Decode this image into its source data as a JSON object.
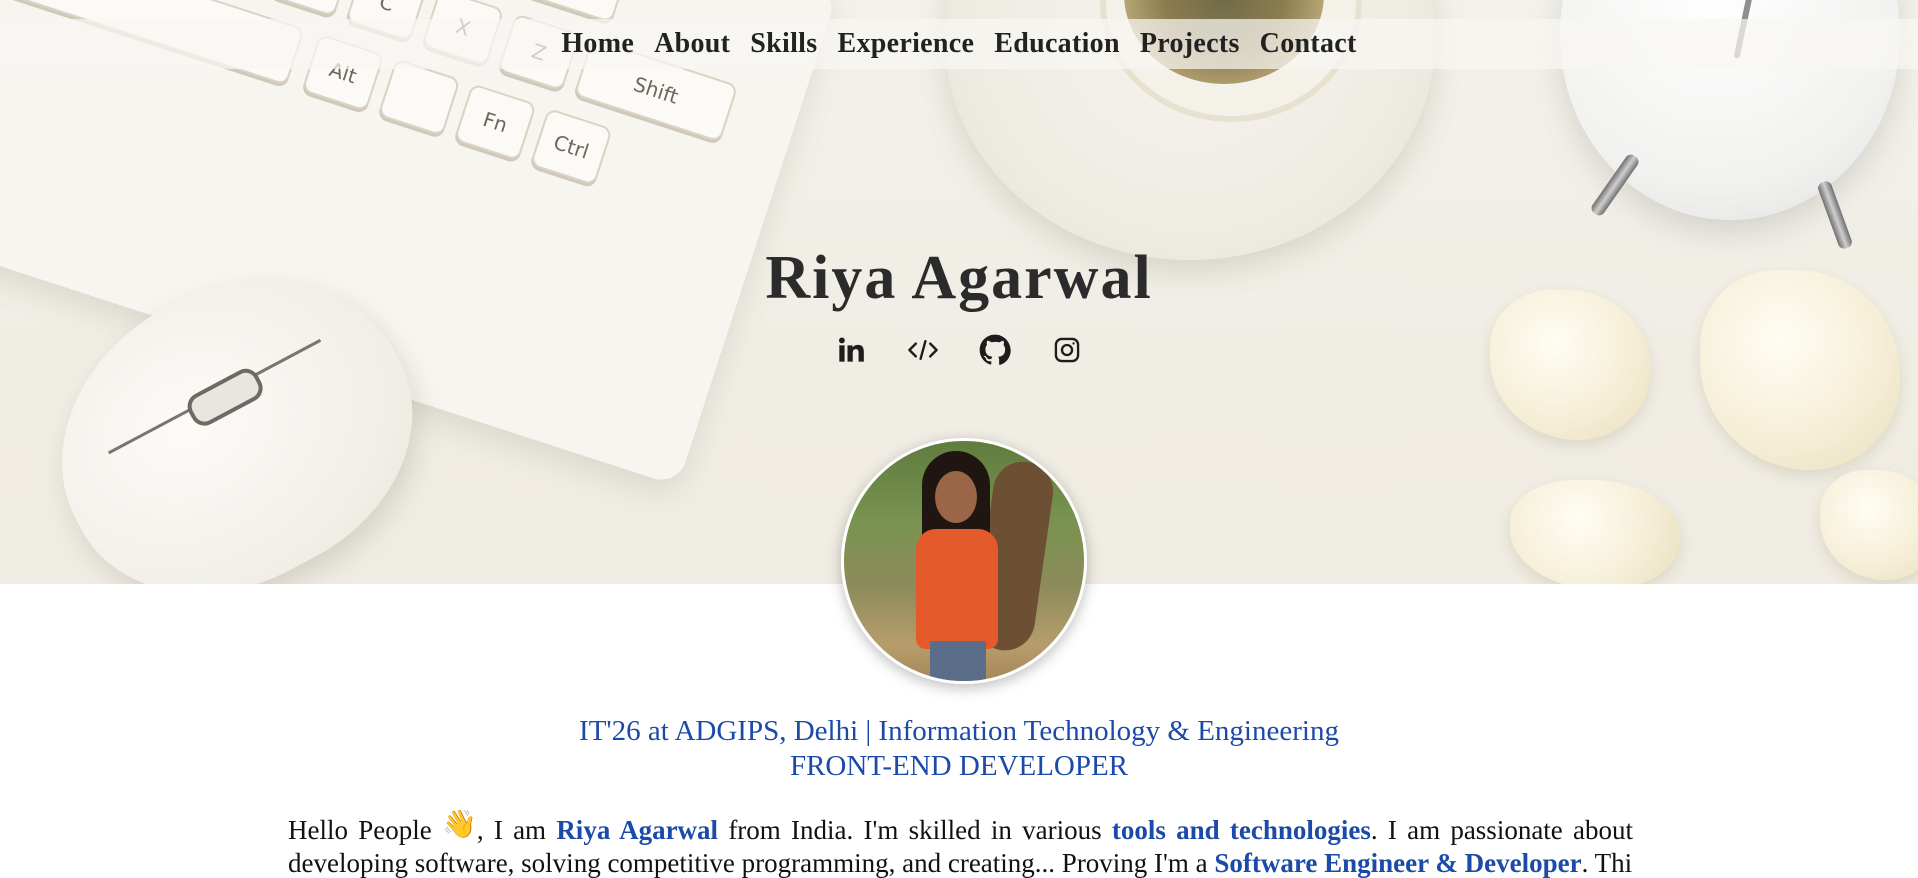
{
  "nav": {
    "items": [
      "Home",
      "About",
      "Skills",
      "Experience",
      "Education",
      "Projects",
      "Contact"
    ]
  },
  "hero": {
    "name": "Riya Agarwal",
    "socials": [
      {
        "icon": "linkedin-icon"
      },
      {
        "icon": "code-icon"
      },
      {
        "icon": "github-icon"
      },
      {
        "icon": "instagram-icon"
      }
    ]
  },
  "about": {
    "tagline_line1": "IT'26 at ADGIPS, Delhi | Information Technology & Engineering",
    "tagline_line2": "FRONT-END DEVELOPER",
    "intro_part1": "Hello People",
    "intro_wave": "👋",
    "intro_part2": ", I am",
    "intro_name": "Riya Agarwal",
    "intro_part3": "from India. I'm skilled in various",
    "intro_skills": "tools and technologies",
    "intro_part4": ". I am passionate about",
    "intro_line2_start": "developing software, solving competitive programming, and creating... Proving I'm a",
    "intro_role": "Software Engineer & Developer",
    "intro_line2_end": ". This"
  },
  "colors": {
    "accent": "#1c4aa8",
    "text": "#111111",
    "heading": "#2b2b2b"
  }
}
